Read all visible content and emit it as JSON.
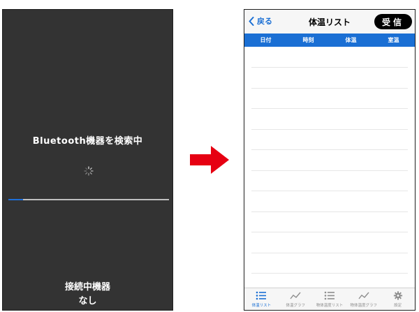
{
  "scan_screen": {
    "title": "Bluetooth機器を検索中",
    "progress": 0.09,
    "connected_label": "接続中機器",
    "connected_value": "なし"
  },
  "list_screen": {
    "back_label": "戻る",
    "title": "体温リスト",
    "receive_label": "受信",
    "columns": [
      "日付",
      "時刻",
      "体温",
      "室温"
    ],
    "tabs": [
      {
        "label": "体温リスト",
        "icon": "list-icon",
        "active": true
      },
      {
        "label": "体温グラフ",
        "icon": "graph-icon",
        "active": false
      },
      {
        "label": "物体温度リスト",
        "icon": "list-icon",
        "active": false
      },
      {
        "label": "物体温度グラフ",
        "icon": "graph-icon",
        "active": false
      },
      {
        "label": "設定",
        "icon": "gear-icon",
        "active": false
      }
    ]
  },
  "colors": {
    "accent": "#1a6fd4",
    "scan_background": "#333333",
    "arrow": "#e60012"
  }
}
